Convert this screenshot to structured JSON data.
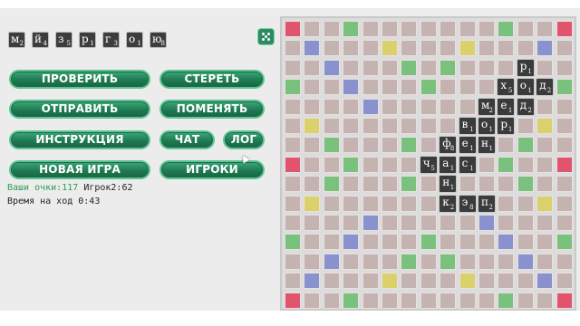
{
  "rack": [
    {
      "letter": "м",
      "points": "2"
    },
    {
      "letter": "й",
      "points": "4"
    },
    {
      "letter": "з",
      "points": "5"
    },
    {
      "letter": "р",
      "points": "1"
    },
    {
      "letter": "г",
      "points": "3"
    },
    {
      "letter": "о",
      "points": "1"
    },
    {
      "letter": "ю",
      "points": "8"
    }
  ],
  "buttons": {
    "check": "ПРОВЕРИТЬ",
    "erase": "СТЕРЕТЬ",
    "send": "ОТПРАВИТЬ",
    "swap": "ПОМЕНЯТЬ",
    "instructions": "ИНСТРУКЦИЯ",
    "chat": "ЧАТ",
    "log": "ЛОГ",
    "new_game": "НОВАЯ ИГРА",
    "players": "ИГРОКИ"
  },
  "status": {
    "my_score_label": "Ваши очки:117",
    "opponent_score": "Игрок2:62",
    "move_time": "Время на ход 0:43"
  },
  "board": {
    "size": 15,
    "bonus_colors": {
      "red": "#e0556d",
      "green": "#79c17c",
      "blue": "#8991ce",
      "yellow": "#dad16d",
      "plain": "#c5b3b1"
    },
    "red": [
      [
        0,
        0
      ],
      [
        0,
        14
      ],
      [
        7,
        0
      ],
      [
        7,
        14
      ],
      [
        14,
        0
      ],
      [
        14,
        14
      ]
    ],
    "green": [
      [
        0,
        3
      ],
      [
        0,
        11
      ],
      [
        2,
        6
      ],
      [
        2,
        8
      ],
      [
        3,
        0
      ],
      [
        3,
        7
      ],
      [
        3,
        14
      ],
      [
        6,
        2
      ],
      [
        6,
        6
      ],
      [
        6,
        8
      ],
      [
        6,
        12
      ],
      [
        7,
        3
      ],
      [
        7,
        11
      ],
      [
        8,
        2
      ],
      [
        8,
        6
      ],
      [
        8,
        8
      ],
      [
        8,
        12
      ],
      [
        11,
        0
      ],
      [
        11,
        7
      ],
      [
        11,
        14
      ],
      [
        12,
        6
      ],
      [
        12,
        8
      ],
      [
        14,
        3
      ],
      [
        14,
        11
      ]
    ],
    "blue": [
      [
        1,
        1
      ],
      [
        1,
        13
      ],
      [
        2,
        2
      ],
      [
        2,
        12
      ],
      [
        3,
        3
      ],
      [
        3,
        11
      ],
      [
        4,
        4
      ],
      [
        4,
        10
      ],
      [
        10,
        4
      ],
      [
        10,
        10
      ],
      [
        11,
        3
      ],
      [
        11,
        11
      ],
      [
        12,
        2
      ],
      [
        12,
        12
      ],
      [
        13,
        1
      ],
      [
        13,
        13
      ]
    ],
    "yellow": [
      [
        1,
        5
      ],
      [
        1,
        9
      ],
      [
        5,
        1
      ],
      [
        5,
        13
      ],
      [
        9,
        1
      ],
      [
        9,
        13
      ],
      [
        13,
        5
      ],
      [
        13,
        9
      ]
    ]
  },
  "tiles": [
    {
      "row": 2,
      "col": 12,
      "letter": "р",
      "points": "1"
    },
    {
      "row": 3,
      "col": 11,
      "letter": "х",
      "points": "5"
    },
    {
      "row": 3,
      "col": 12,
      "letter": "о",
      "points": "1"
    },
    {
      "row": 3,
      "col": 13,
      "letter": "д",
      "points": "2"
    },
    {
      "row": 4,
      "col": 10,
      "letter": "м",
      "points": "2"
    },
    {
      "row": 4,
      "col": 11,
      "letter": "е",
      "points": "1"
    },
    {
      "row": 4,
      "col": 12,
      "letter": "д",
      "points": "2"
    },
    {
      "row": 5,
      "col": 9,
      "letter": "в",
      "points": "1"
    },
    {
      "row": 5,
      "col": 10,
      "letter": "о",
      "points": "1"
    },
    {
      "row": 5,
      "col": 11,
      "letter": "р",
      "points": "1"
    },
    {
      "row": 6,
      "col": 8,
      "letter": "ф",
      "points": "8"
    },
    {
      "row": 6,
      "col": 9,
      "letter": "е",
      "points": "1"
    },
    {
      "row": 6,
      "col": 10,
      "letter": "н",
      "points": "1"
    },
    {
      "row": 7,
      "col": 7,
      "letter": "ч",
      "points": "5"
    },
    {
      "row": 7,
      "col": 8,
      "letter": "а",
      "points": "1"
    },
    {
      "row": 7,
      "col": 9,
      "letter": "с",
      "points": "1"
    },
    {
      "row": 8,
      "col": 8,
      "letter": "н",
      "points": "1"
    },
    {
      "row": 9,
      "col": 8,
      "letter": "к",
      "points": "2"
    },
    {
      "row": 9,
      "col": 9,
      "letter": "э",
      "points": "8"
    },
    {
      "row": 9,
      "col": 10,
      "letter": "п",
      "points": "2"
    }
  ]
}
